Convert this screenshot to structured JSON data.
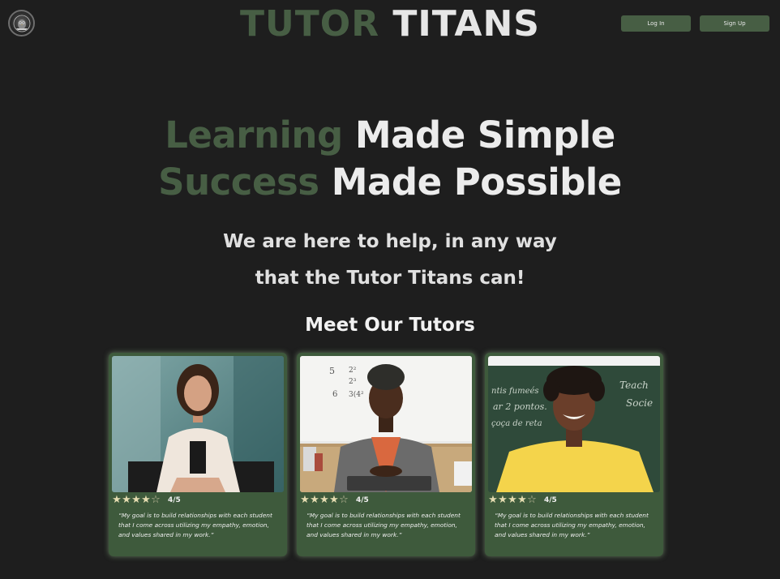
{
  "header": {
    "brand_first": "TUTOR",
    "brand_second": "TITANS",
    "login_label": "Log In",
    "signup_label": "Sign Up",
    "logo_icon": "owl-emblem-icon"
  },
  "hero": {
    "line1_green": "Learning",
    "line1_white": "Made Simple",
    "line2_green": "Success",
    "line2_white": "Made Possible",
    "sub_line1": "We are here to help, in any way",
    "sub_line2": "that the Tutor Titans can!"
  },
  "tutors_section": {
    "heading": "Meet Our Tutors",
    "tutors": [
      {
        "rating": "4/5",
        "stars_filled": 4,
        "stars_total": 5,
        "quote": "“My goal is to build relationships with each student that I come across utilizing my empathy, emotion, and values shared in my work.”"
      },
      {
        "rating": "4/5",
        "stars_filled": 4,
        "stars_total": 5,
        "quote": "“My goal is to build relationships with each student that I come across utilizing my empathy, emotion, and values shared in my work.”"
      },
      {
        "rating": "4/5",
        "stars_filled": 4,
        "stars_total": 5,
        "quote": "“My goal is to build relationships with each student that I come across utilizing my empathy, emotion, and values shared in my work.”"
      }
    ]
  },
  "colors": {
    "background": "#1e1e1e",
    "accent_green": "#475e44",
    "card_green": "#3e5a3c",
    "text_light": "#ececec",
    "star": "#e4dcb0"
  }
}
